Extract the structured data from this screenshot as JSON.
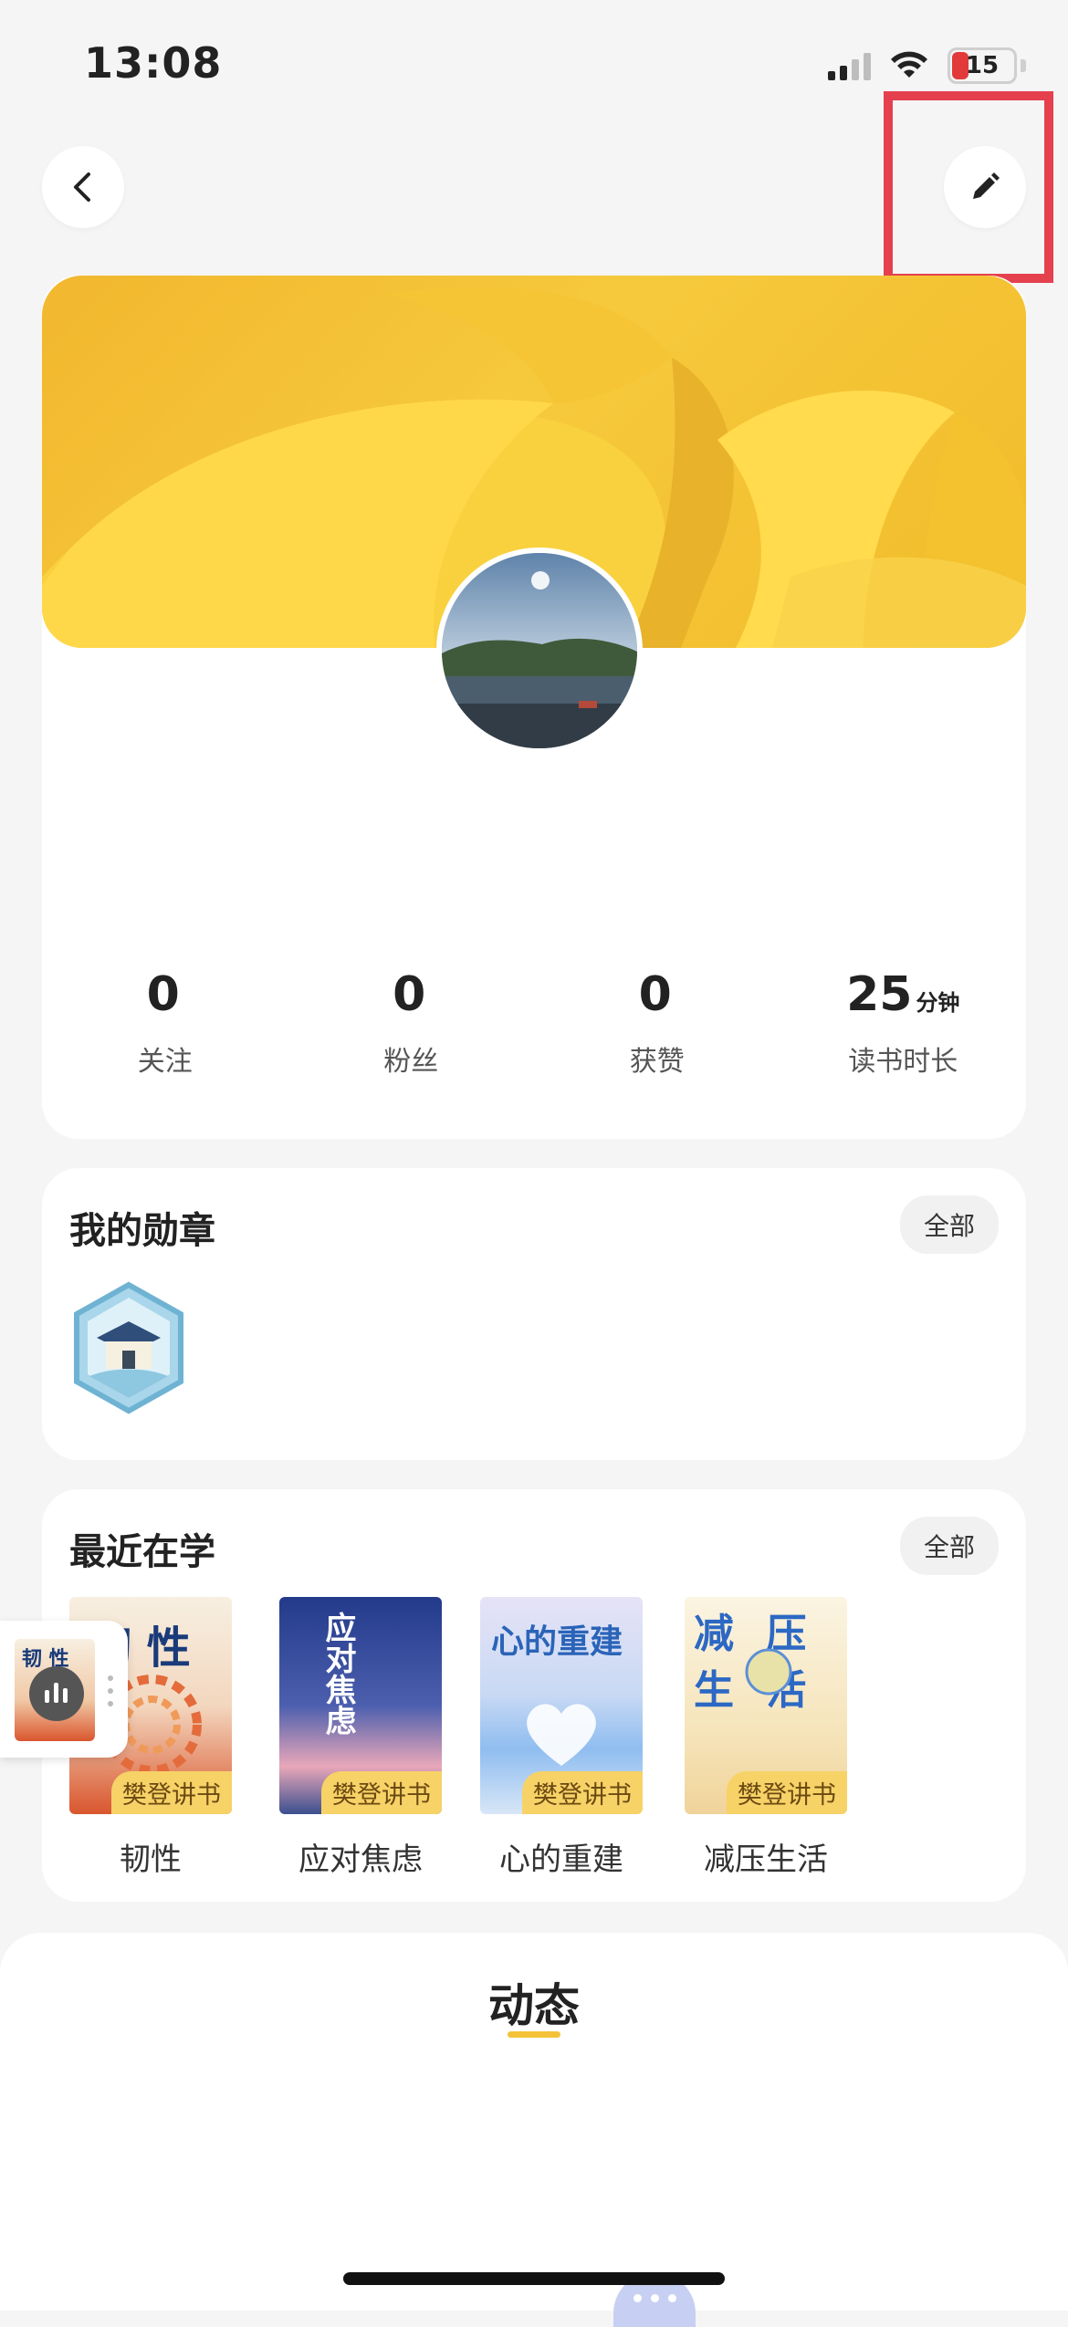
{
  "status": {
    "time": "13:08",
    "battery": "15"
  },
  "profile": {
    "stats": [
      {
        "value": "0",
        "unit": "",
        "label": "关注"
      },
      {
        "value": "0",
        "unit": "",
        "label": "粉丝"
      },
      {
        "value": "0",
        "unit": "",
        "label": "获赞"
      },
      {
        "value": "25",
        "unit": "分钟",
        "label": "读书时长"
      }
    ]
  },
  "medals": {
    "title": "我的勋章",
    "all_label": "全部"
  },
  "recent": {
    "title": "最近在学",
    "all_label": "全部",
    "books": [
      {
        "title": "韧性",
        "cover_text": "韧 性",
        "tag": "樊登讲书"
      },
      {
        "title": "应对焦虑",
        "cover_text": "应对焦虑",
        "tag": "樊登讲书"
      },
      {
        "title": "心的重建",
        "cover_text": "心的重建",
        "tag": "樊登讲书"
      },
      {
        "title": "减压生活",
        "cover_text": "减 压 生 活",
        "tag": "樊登讲书"
      }
    ],
    "mini_player_text": "韧 性"
  },
  "feed": {
    "tab_label": "动态"
  },
  "colors": {
    "accent": "#f4c23a",
    "banner": "#f2b72e",
    "highlight": "#e5404e"
  }
}
